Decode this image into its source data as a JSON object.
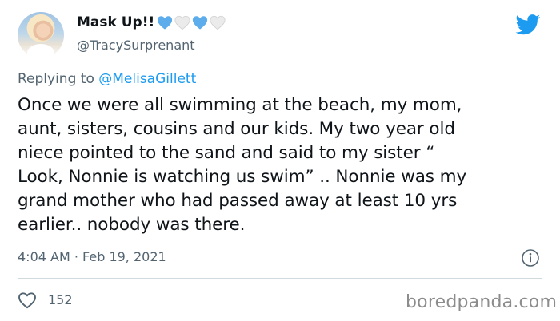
{
  "tweet": {
    "display_name": "Mask Up!!",
    "handle": "@TracySurprenant",
    "reply_prefix": "Replying to",
    "reply_mention": "@MelisaGillett",
    "text": "Once we were all swimming at the beach, my mom,\naunt, sisters, cousins and our kids. My two year old\nniece pointed to the sand and said to my sister “\nLook, Nonnie is watching us swim” .. Nonnie was my\ngrand mother who had passed away at least 10 yrs\nearlier.. nobody was there.",
    "timestamp": "4:04 AM · Feb 19, 2021",
    "like_count": "152"
  },
  "name_emojis": [
    "blue-heart-icon",
    "white-heart-icon",
    "blue-heart-icon",
    "white-heart-icon"
  ],
  "icons": {
    "brand": "twitter-bird-icon",
    "info": "info-icon",
    "like": "heart-outline-icon"
  },
  "watermark": "boredpanda.com",
  "colors": {
    "twitter_blue": "#1d9bf0",
    "secondary_text": "#536471",
    "primary_text": "#0f1419",
    "divider": "#cfd9de",
    "watermark": "#8c8c8c"
  }
}
